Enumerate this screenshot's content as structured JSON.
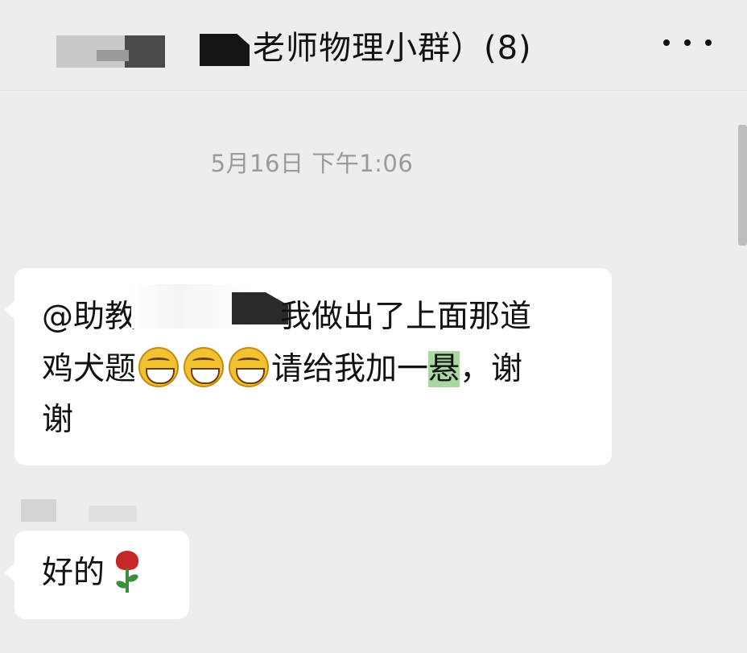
{
  "header": {
    "title": "老师物理小群）(8)",
    "more_icon": "more-dots-icon"
  },
  "chat": {
    "timestamp": "5月16日 下午1:06",
    "messages": [
      {
        "line1_prefix": "@助教",
        "line1_rest": "我做出了上面那道",
        "line2_a": "鸡犬题",
        "line2_b": "请给我加一",
        "line2_highlight": "悬",
        "line2_c": "，谢",
        "line3": "谢",
        "emoji_icon": "grinning-face-emoji"
      },
      {
        "text": "好的",
        "emoji_icon": "rose-emoji"
      }
    ]
  },
  "colors": {
    "background": "#ededed",
    "bubble": "#ffffff",
    "highlight": "#a9d7a2",
    "timestamp": "#9a9a9a"
  }
}
